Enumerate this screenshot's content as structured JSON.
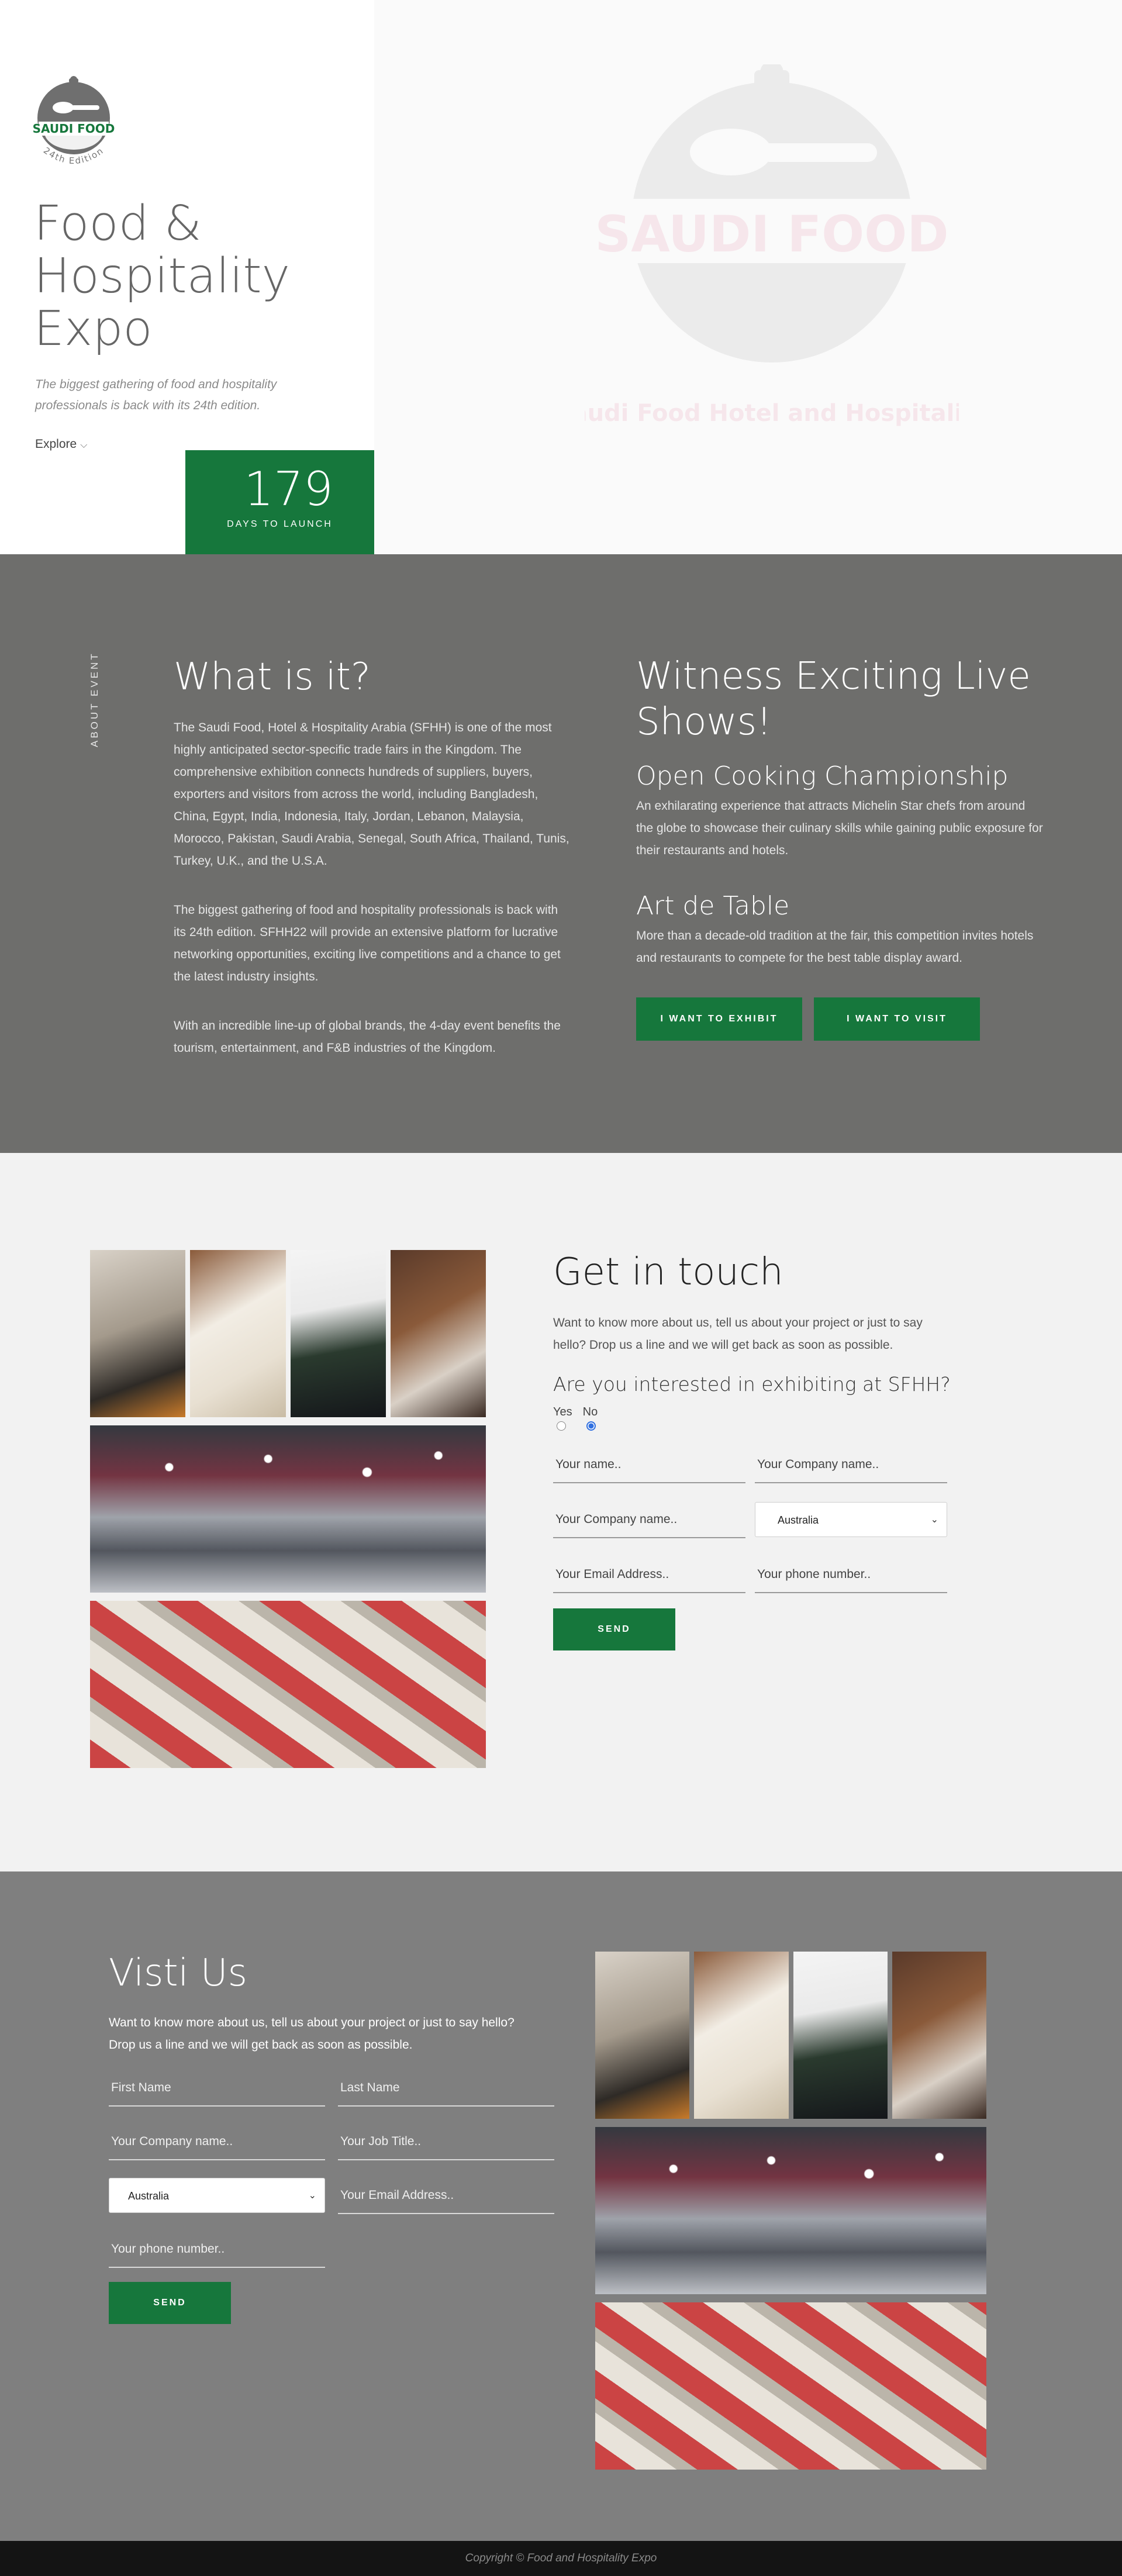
{
  "colors": {
    "brand_green": "#16773c",
    "about_bg": "#6e6e6c",
    "contact_bg": "#f2f2f2",
    "visit_bg": "#7f7f7f",
    "footer_bg": "#141414"
  },
  "hero": {
    "logo_text": "SAUDI FOOD",
    "logo_edition": "24th Edition",
    "title": "Food & Hospitality Expo",
    "subtitle": "The biggest gathering of food and hospitality professionals is back with its 24th edition.",
    "explore_label": "Explore",
    "countdown_value": "179",
    "countdown_label": "DAYS TO LAUNCH",
    "watermark_logo_text": "SAUDI FOOD",
    "watermark_tagline": "Saudi Food Hotel and Hospitality"
  },
  "about": {
    "side_label": "ABOUT EVENT",
    "title": "What is it?",
    "paragraphs": [
      "The Saudi Food, Hotel & Hospitality Arabia (SFHH) is one of the most highly anticipated sector-specific trade fairs in the Kingdom. The comprehensive exhibition connects hundreds of suppliers, buyers, exporters and visitors from across the world, including Bangladesh, China, Egypt, India, Indonesia, Italy, Jordan, Lebanon, Malaysia, Morocco, Pakistan, Saudi Arabia, Senegal, South Africa, Thailand, Tunis, Turkey, U.K., and the U.S.A.",
      "The biggest gathering of food and hospitality professionals is back with its 24th edition. SFHH22 will provide an extensive platform for lucrative networking opportunities, exciting live competitions and a chance to get the latest industry insights.",
      "With an incredible line-up of global brands, the 4-day event benefits the tourism, entertainment, and F&B industries of the Kingdom."
    ],
    "shows_title": "Witness Exciting Live Shows!",
    "shows": [
      {
        "title": "Open Cooking Championship",
        "text": "An exhilarating experience that attracts Michelin Star chefs from around the globe to showcase their culinary skills while gaining public exposure for their restaurants and hotels."
      },
      {
        "title": "Art de Table",
        "text": "More than a decade-old tradition at the fair, this competition invites hotels and restaurants to compete for the best table display award."
      }
    ],
    "exhibit_button": "I WANT TO EXHIBIT",
    "visit_button": "I WANT TO VISIT"
  },
  "contact": {
    "title": "Get in touch",
    "intro": "Want to know more about us, tell us about your project or just to say hello? Drop us a line and we will get back as soon as possible.",
    "question": "Are you interested in exhibiting at SFHH?",
    "yes_label": "Yes",
    "no_label": "No",
    "selected": "No",
    "name_placeholder": "Your name..",
    "company_placeholder": "Your Company name..",
    "company2_placeholder": "Your Company name..",
    "country_value": "Australia",
    "email_placeholder": "Your Email Address..",
    "phone_placeholder": "Your phone number..",
    "send_label": "SEND"
  },
  "visit": {
    "title": "Visti Us",
    "intro": "Want to know more about us, tell us about your project or just to say hello? Drop us a line and we will get back as soon as possible.",
    "first_name_placeholder": "First Name",
    "last_name_placeholder": "Last Name",
    "company_placeholder": "Your Company name..",
    "job_placeholder": "Your Job Title..",
    "country_value": "Australia",
    "email_placeholder": "Your Email Address..",
    "phone_placeholder": "Your phone number..",
    "send_label": "SEND"
  },
  "footer": {
    "copyright": "Copyright © Food and Hospitality Expo"
  }
}
